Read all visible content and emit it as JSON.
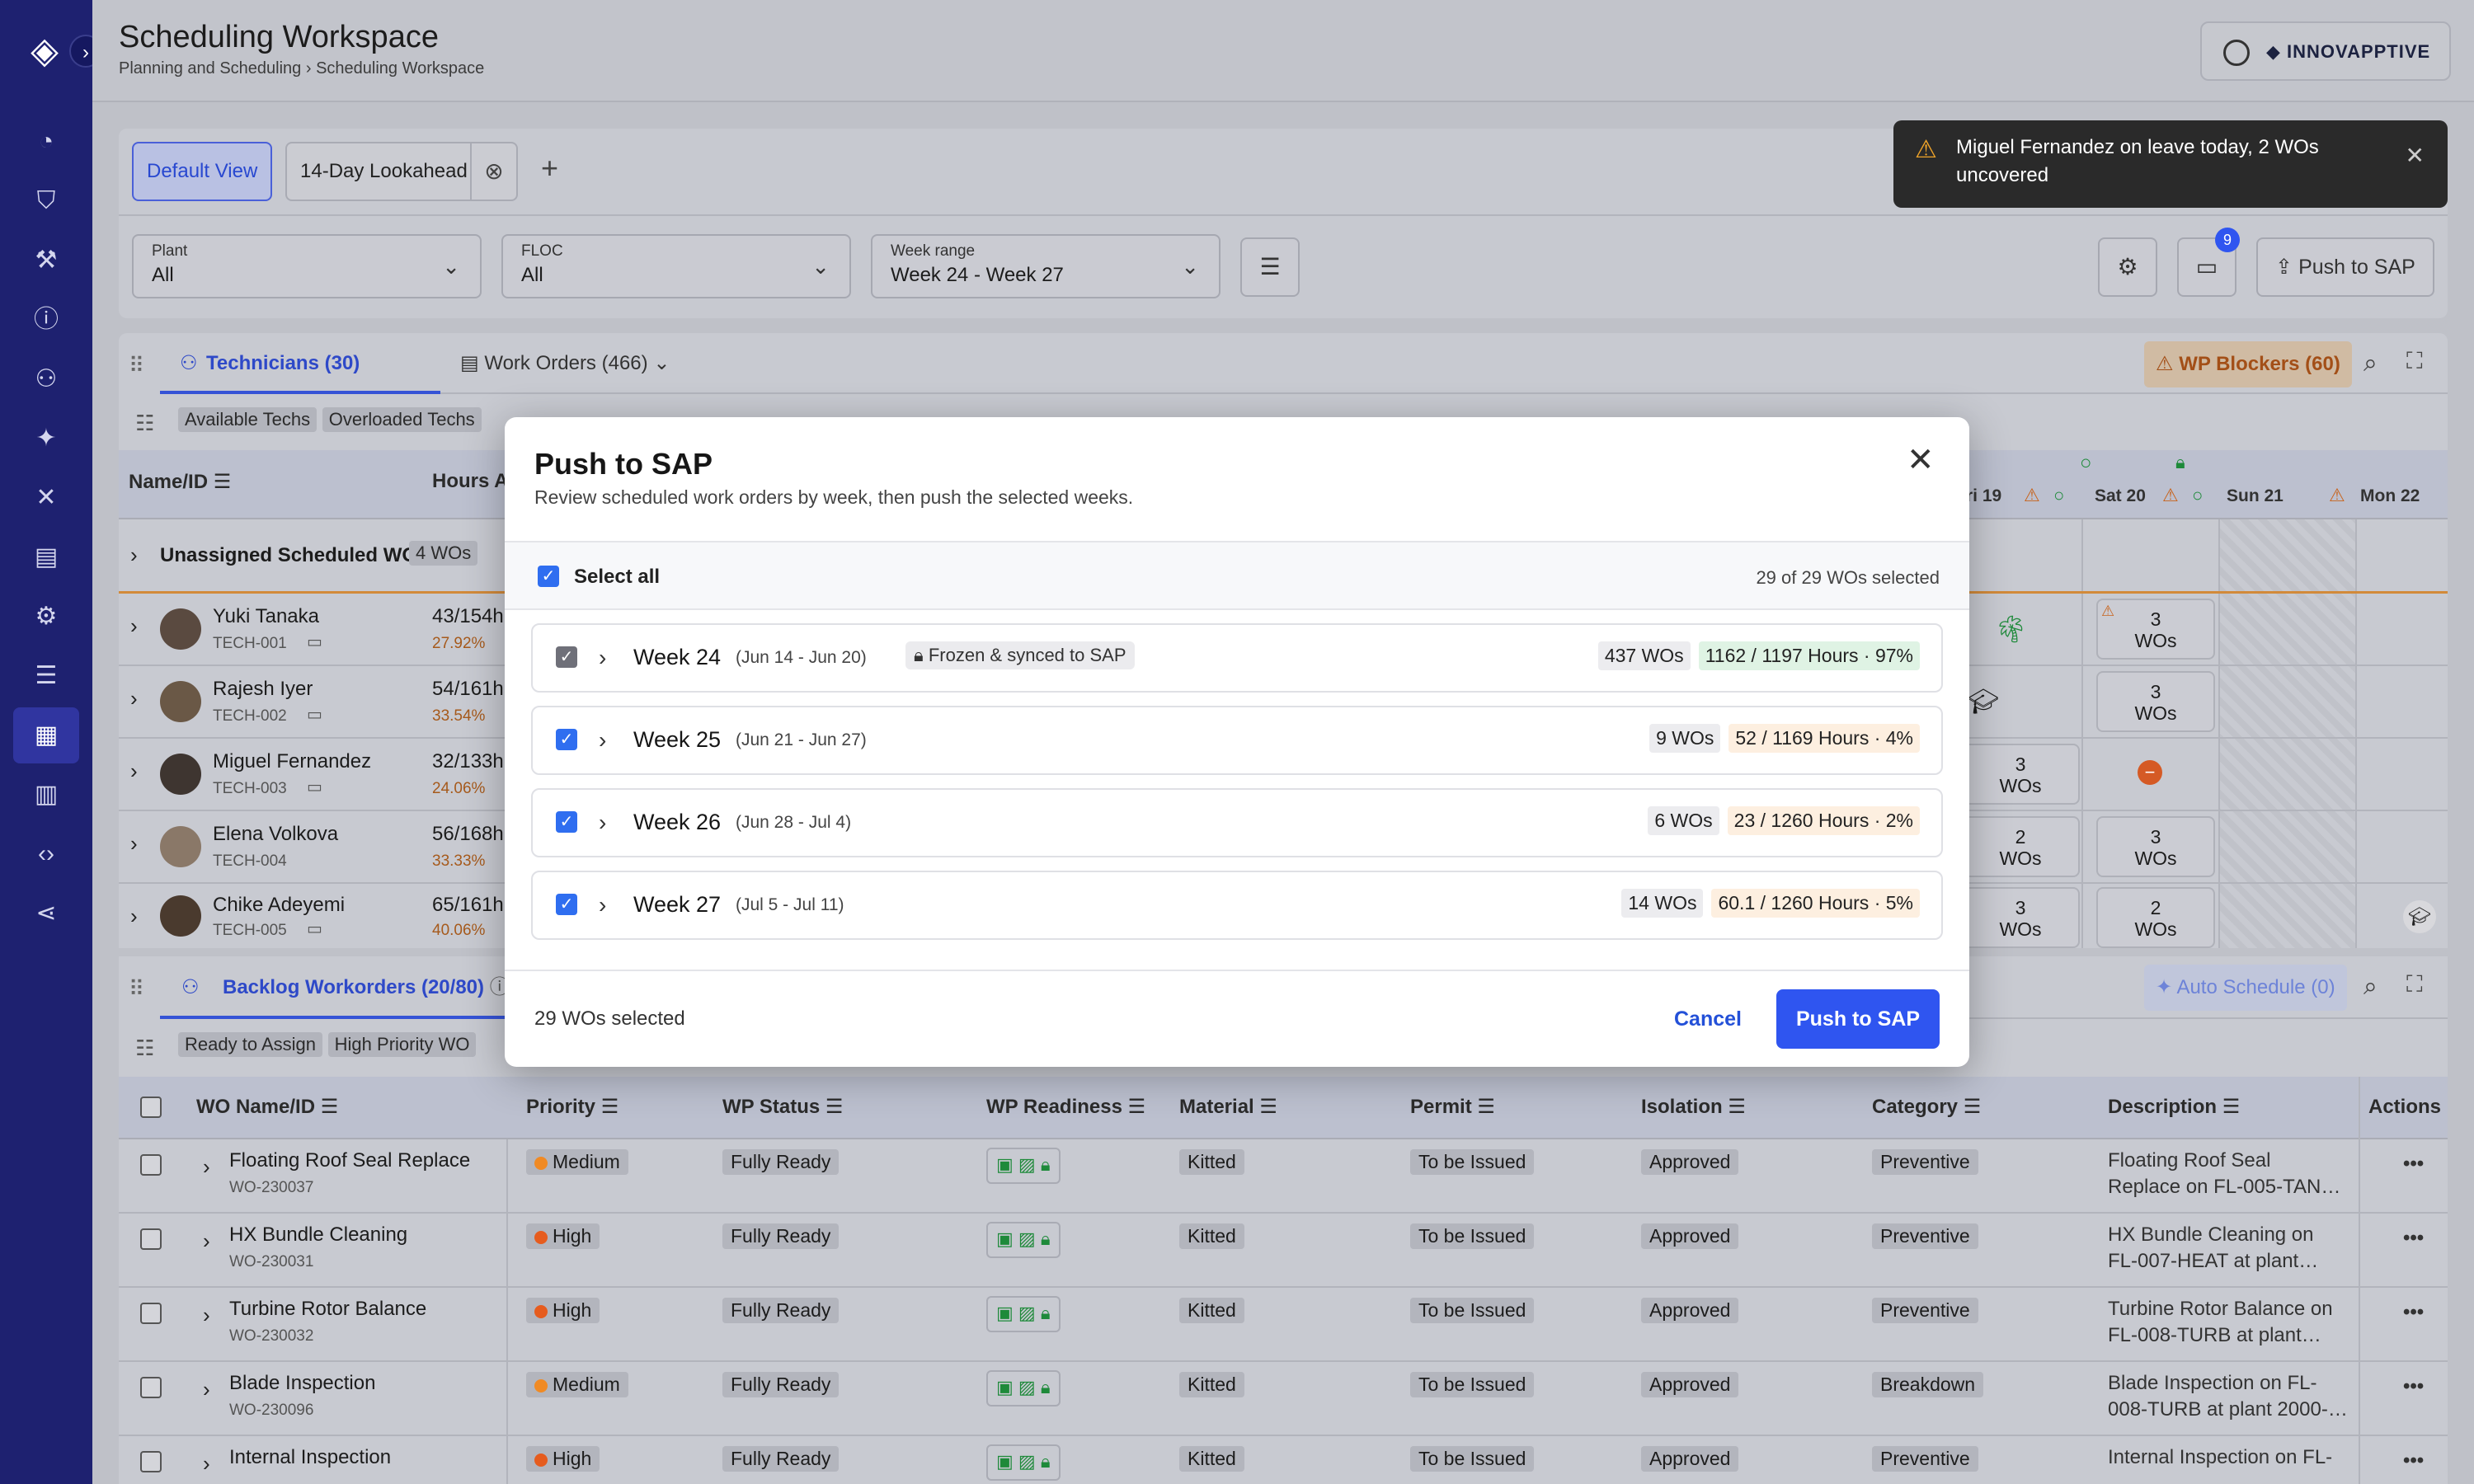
{
  "header": {
    "title": "Scheduling Workspace",
    "breadcrumb": [
      "Planning and Scheduling",
      "Scheduling Workspace"
    ],
    "brand": "INNOVAPPTIVE"
  },
  "view_tabs": {
    "default": "Default View",
    "lookahead": "14-Day Lookahead",
    "add": "+"
  },
  "filters": {
    "plant": {
      "label": "Plant",
      "value": "All"
    },
    "floc": {
      "label": "FLOC",
      "value": "All"
    },
    "week_range": {
      "label": "Week range",
      "value": "Week 24 - Week 27"
    },
    "chat_badge": "9",
    "push_to_sap": "Push to SAP"
  },
  "toast": {
    "message": "Miguel Fernandez on leave today, 2 WOs uncovered"
  },
  "tech_panel": {
    "tab_technicians": "Technicians (30)",
    "tab_work_orders": "Work Orders (466)",
    "wp_blockers": "WP Blockers (60)",
    "chips": [
      "Available Techs",
      "Overloaded Techs"
    ],
    "col_name": "Name/ID",
    "col_hours": "Hours A",
    "days": [
      "ri 19",
      "Sat 20",
      "Sun 21",
      "Mon 22"
    ],
    "unassigned": {
      "label": "Unassigned Scheduled WO",
      "count": "4 WOs"
    },
    "techs": [
      {
        "name": "Yuki Tanaka",
        "id": "TECH-001",
        "hours": "43/154h",
        "pct": "27.92%"
      },
      {
        "name": "Rajesh Iyer",
        "id": "TECH-002",
        "hours": "54/161h",
        "pct": "33.54%"
      },
      {
        "name": "Miguel Fernandez",
        "id": "TECH-003",
        "hours": "32/133h",
        "pct": "24.06%"
      },
      {
        "name": "Elena Volkova",
        "id": "TECH-004",
        "hours": "56/168h",
        "pct": "33.33%"
      },
      {
        "name": "Chike Adeyemi",
        "id": "TECH-005",
        "hours": "65/161h",
        "pct": "40.06%"
      }
    ],
    "cells": {
      "wos3": "3",
      "wos2": "2",
      "wos_unit": "WOs"
    }
  },
  "backlog": {
    "tab": "Backlog Workorders (20/80)",
    "auto_schedule": "Auto Schedule (0)",
    "chips": [
      "Ready to Assign",
      "High Priority WO"
    ],
    "columns": [
      "WO Name/ID",
      "Priority",
      "WP Status",
      "WP Readiness",
      "Material",
      "Permit",
      "Isolation",
      "Category",
      "Description",
      "Actions"
    ],
    "rows": [
      {
        "name": "Floating Roof Seal Replace",
        "id": "WO-230037",
        "priority": "Medium",
        "status": "Fully Ready",
        "material": "Kitted",
        "permit": "To be Issued",
        "isolation": "Approved",
        "category": "Preventive",
        "desc1": "Floating Roof Seal",
        "desc2": "Replace on FL-005-TAN…"
      },
      {
        "name": "HX Bundle Cleaning",
        "id": "WO-230031",
        "priority": "High",
        "status": "Fully Ready",
        "material": "Kitted",
        "permit": "To be Issued",
        "isolation": "Approved",
        "category": "Preventive",
        "desc1": "HX Bundle Cleaning on",
        "desc2": "FL-007-HEAT at plant…"
      },
      {
        "name": "Turbine Rotor Balance",
        "id": "WO-230032",
        "priority": "High",
        "status": "Fully Ready",
        "material": "Kitted",
        "permit": "To be Issued",
        "isolation": "Approved",
        "category": "Preventive",
        "desc1": "Turbine Rotor Balance on",
        "desc2": "FL-008-TURB at plant…"
      },
      {
        "name": "Blade Inspection",
        "id": "WO-230096",
        "priority": "Medium",
        "status": "Fully Ready",
        "material": "Kitted",
        "permit": "To be Issued",
        "isolation": "Approved",
        "category": "Breakdown",
        "desc1": "Blade Inspection on FL-",
        "desc2": "008-TURB at plant 2000-…"
      },
      {
        "name": "Internal Inspection",
        "id": "",
        "priority": "High",
        "status": "Fully Ready",
        "material": "Kitted",
        "permit": "To be Issued",
        "isolation": "Approved",
        "category": "Preventive",
        "desc1": "Internal Inspection on FL-",
        "desc2": ""
      }
    ],
    "actions_glyph": "•••"
  },
  "colors": {
    "sidebar": "#1e2170",
    "accent": "#2f55f0",
    "high": "#e65c1e",
    "medium": "#f08a24",
    "ready_green": "#1e8a3a"
  },
  "modal": {
    "title": "Push to SAP",
    "subtitle": "Review scheduled work orders by week, then push the selected weeks.",
    "select_all": "Select all",
    "selected_summary": "29 of 29 WOs selected",
    "weeks": [
      {
        "name": "Week 24",
        "dates": "(Jun 14 - Jun 20)",
        "frozen": "Frozen & synced to SAP",
        "wos": "437 WOs",
        "hours": "1162 / 1197 Hours · 97%"
      },
      {
        "name": "Week 25",
        "dates": "(Jun 21 - Jun 27)",
        "wos": "9 WOs",
        "hours": "52 / 1169 Hours · 4%"
      },
      {
        "name": "Week 26",
        "dates": "(Jun 28 - Jul 4)",
        "wos": "6 WOs",
        "hours": "23 / 1260 Hours · 2%"
      },
      {
        "name": "Week 27",
        "dates": "(Jul 5 - Jul 11)",
        "wos": "14 WOs",
        "hours": "60.1 / 1260 Hours · 5%"
      }
    ],
    "footer_count": "29 WOs selected",
    "cancel": "Cancel",
    "push": "Push to SAP"
  }
}
